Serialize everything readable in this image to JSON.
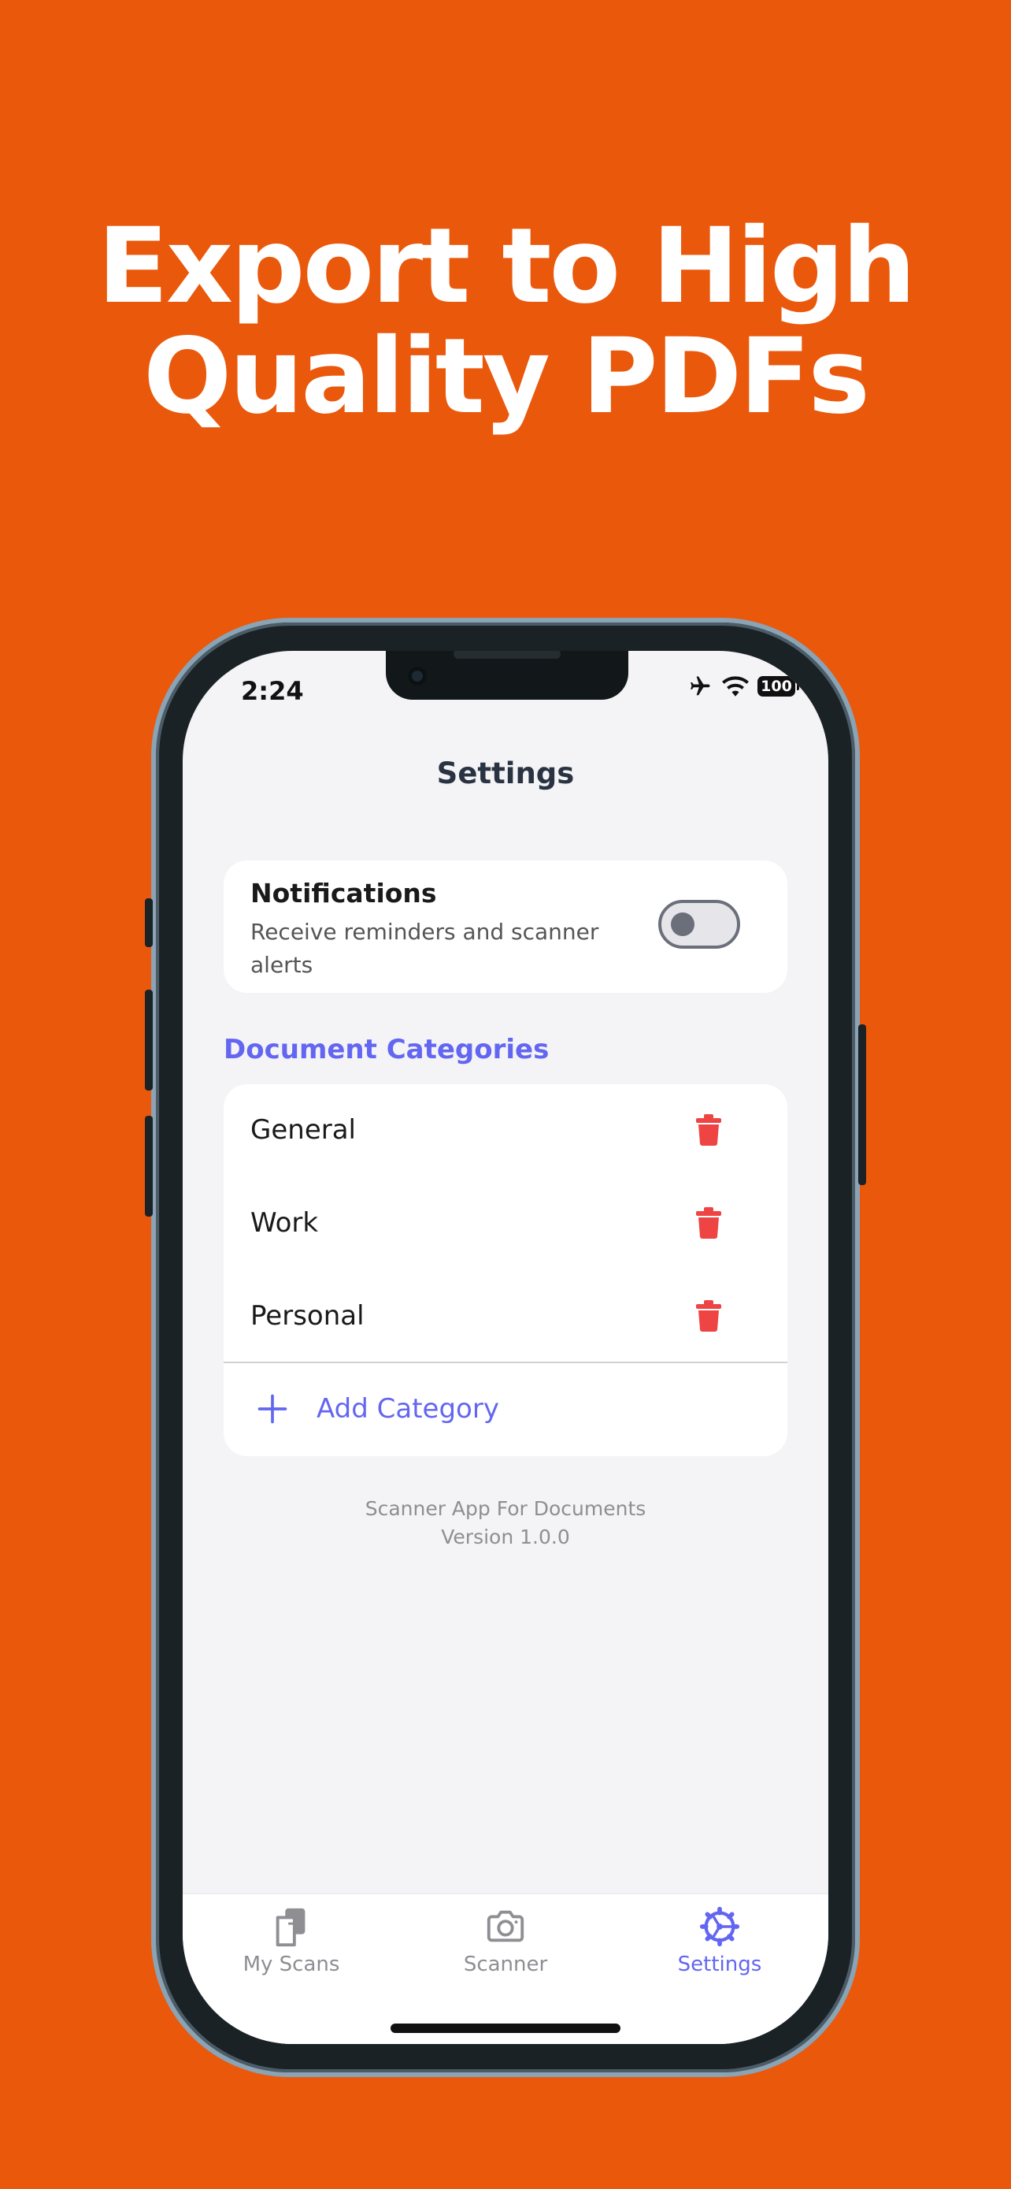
{
  "headline": {
    "line1": "Export to High",
    "line2": "Quality PDFs"
  },
  "status_bar": {
    "time": "2:24",
    "battery": "100"
  },
  "nav": {
    "title": "Settings"
  },
  "notifications": {
    "title": "Notifications",
    "description": "Receive reminders and scanner alerts",
    "enabled": false
  },
  "categories": {
    "header": "Document Categories",
    "items": [
      {
        "label": "General"
      },
      {
        "label": "Work"
      },
      {
        "label": "Personal"
      }
    ],
    "add_label": "Add Category"
  },
  "footer": {
    "app_name": "Scanner App For Documents",
    "version": "Version 1.0.0"
  },
  "tabs": [
    {
      "label": "My Scans",
      "icon": "document-stack-icon",
      "active": false
    },
    {
      "label": "Scanner",
      "icon": "camera-icon",
      "active": false
    },
    {
      "label": "Settings",
      "icon": "gear-icon",
      "active": true
    }
  ],
  "colors": {
    "background": "#EA580C",
    "accent": "#6366F1",
    "danger": "#EF4444",
    "screen_bg": "#F4F4F6"
  }
}
